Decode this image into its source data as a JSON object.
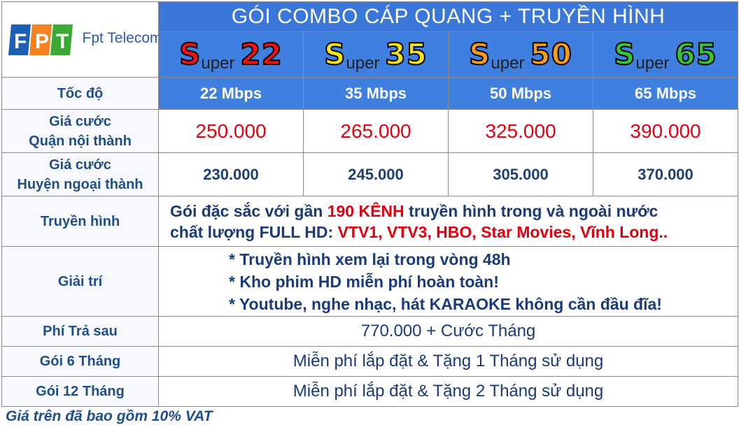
{
  "logo": {
    "text": "Fpt Telecom",
    "mark_letters": "FPT"
  },
  "header": {
    "title": "GÓI COMBO CÁP QUANG + TRUYỀN HÌNH"
  },
  "packages": [
    {
      "cap": "S",
      "word": "uper",
      "num": "22",
      "color": "#e8141a"
    },
    {
      "cap": "S",
      "word": "uper",
      "num": "35",
      "color": "#f4e31a"
    },
    {
      "cap": "S",
      "word": "uper",
      "num": "50",
      "color": "#f39b1c"
    },
    {
      "cap": "S",
      "word": "uper",
      "num": "65",
      "color": "#36c23a"
    }
  ],
  "rows": {
    "speed": {
      "label": "Tốc độ",
      "values": [
        "22 Mbps",
        "35 Mbps",
        "50 Mbps",
        "65 Mbps"
      ]
    },
    "price_inner": {
      "label_line1": "Giá cước",
      "label_line2": "Quận nội thành",
      "values": [
        "250.000",
        "265.000",
        "325.000",
        "390.000"
      ]
    },
    "price_outer": {
      "label_line1": "Giá cước",
      "label_line2": "Huyện ngoại thành",
      "values": [
        "230.000",
        "245.000",
        "305.000",
        "370.000"
      ]
    },
    "tv": {
      "label": "Truyền hình",
      "line1_a": "Gói đặc sắc với gần ",
      "line1_b": "190 KÊNH",
      "line1_c": " truyền hình trong và ngoài nước",
      "line2_a": "chất lượng FULL HD: ",
      "line2_b": "VTV1, VTV3, HBO, Star Movies, Vĩnh Long.."
    },
    "entertainment": {
      "label": "Giải trí",
      "items": [
        "* Truyền hình xem lại trong vòng 48h",
        "* Kho phim HD miễn phí hoàn toàn!",
        "* Youtube, nghe nhạc, hát KARAOKE không cần đầu đĩa!"
      ]
    },
    "postpaid": {
      "label": "Phí Trả sau",
      "value": "770.000 + Cước Tháng"
    },
    "six_month": {
      "label": "Gói 6 Tháng",
      "value": "Miễn phí lắp đặt & Tặng 1 Tháng sử dụng"
    },
    "twelve_month": {
      "label": "Gói 12 Tháng",
      "value": "Miễn phí lắp đặt & Tặng 2 Tháng sử dụng"
    }
  },
  "footer": {
    "note": "Giá trên đã bao gồm 10% VAT"
  }
}
